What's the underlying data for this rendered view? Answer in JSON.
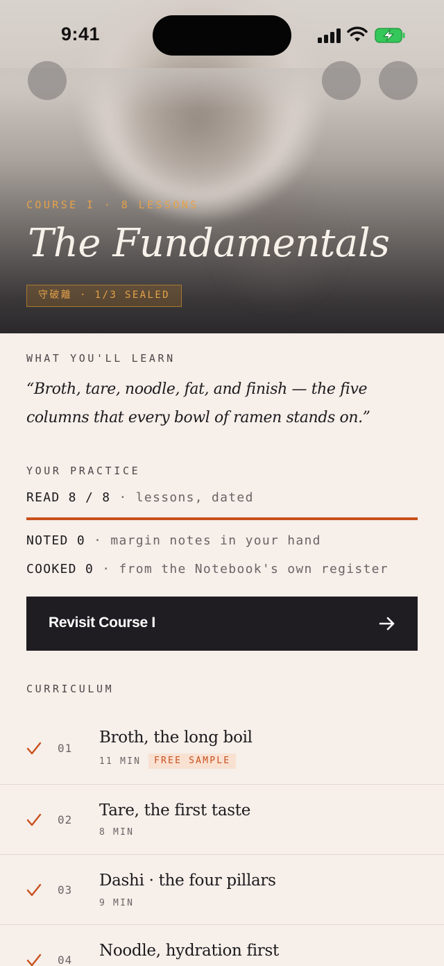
{
  "status_bar": {
    "time": "9:41"
  },
  "hero": {
    "eyebrow": "COURSE I · 8 LESSONS",
    "title": "The Fundamentals",
    "seal_badge": "守破離 · 1/3 SEALED"
  },
  "learn": {
    "label": "WHAT YOU'LL LEARN",
    "quote": "“Broth, tare, noodle, fat, and finish — the five columns that every bowl of ramen stands on.”"
  },
  "practice": {
    "label": "YOUR PRACTICE",
    "read": {
      "key": "READ 8 / 8",
      "value": "· lessons, dated",
      "progress": 1.0
    },
    "noted": {
      "key": "NOTED 0",
      "value": "· margin notes in your hand"
    },
    "cooked": {
      "key": "COOKED 0",
      "value": "· from the Notebook's own register"
    }
  },
  "cta": {
    "label": "Revisit Course I"
  },
  "curriculum": {
    "label": "CURRICULUM",
    "lessons": [
      {
        "num": "01",
        "title": "Broth, the long boil",
        "duration": "11 MIN",
        "tag": "FREE SAMPLE",
        "done": true
      },
      {
        "num": "02",
        "title": "Tare, the first taste",
        "duration": "8 MIN",
        "done": true
      },
      {
        "num": "03",
        "title": "Dashi · the four pillars",
        "duration": "9 MIN",
        "done": true
      },
      {
        "num": "04",
        "title": "Noodle, hydration first",
        "duration": "",
        "done": true
      }
    ]
  },
  "colors": {
    "accent": "#c9501c",
    "gold": "#e4a24a",
    "background": "#f6efea",
    "ink": "#1c1a1d"
  }
}
